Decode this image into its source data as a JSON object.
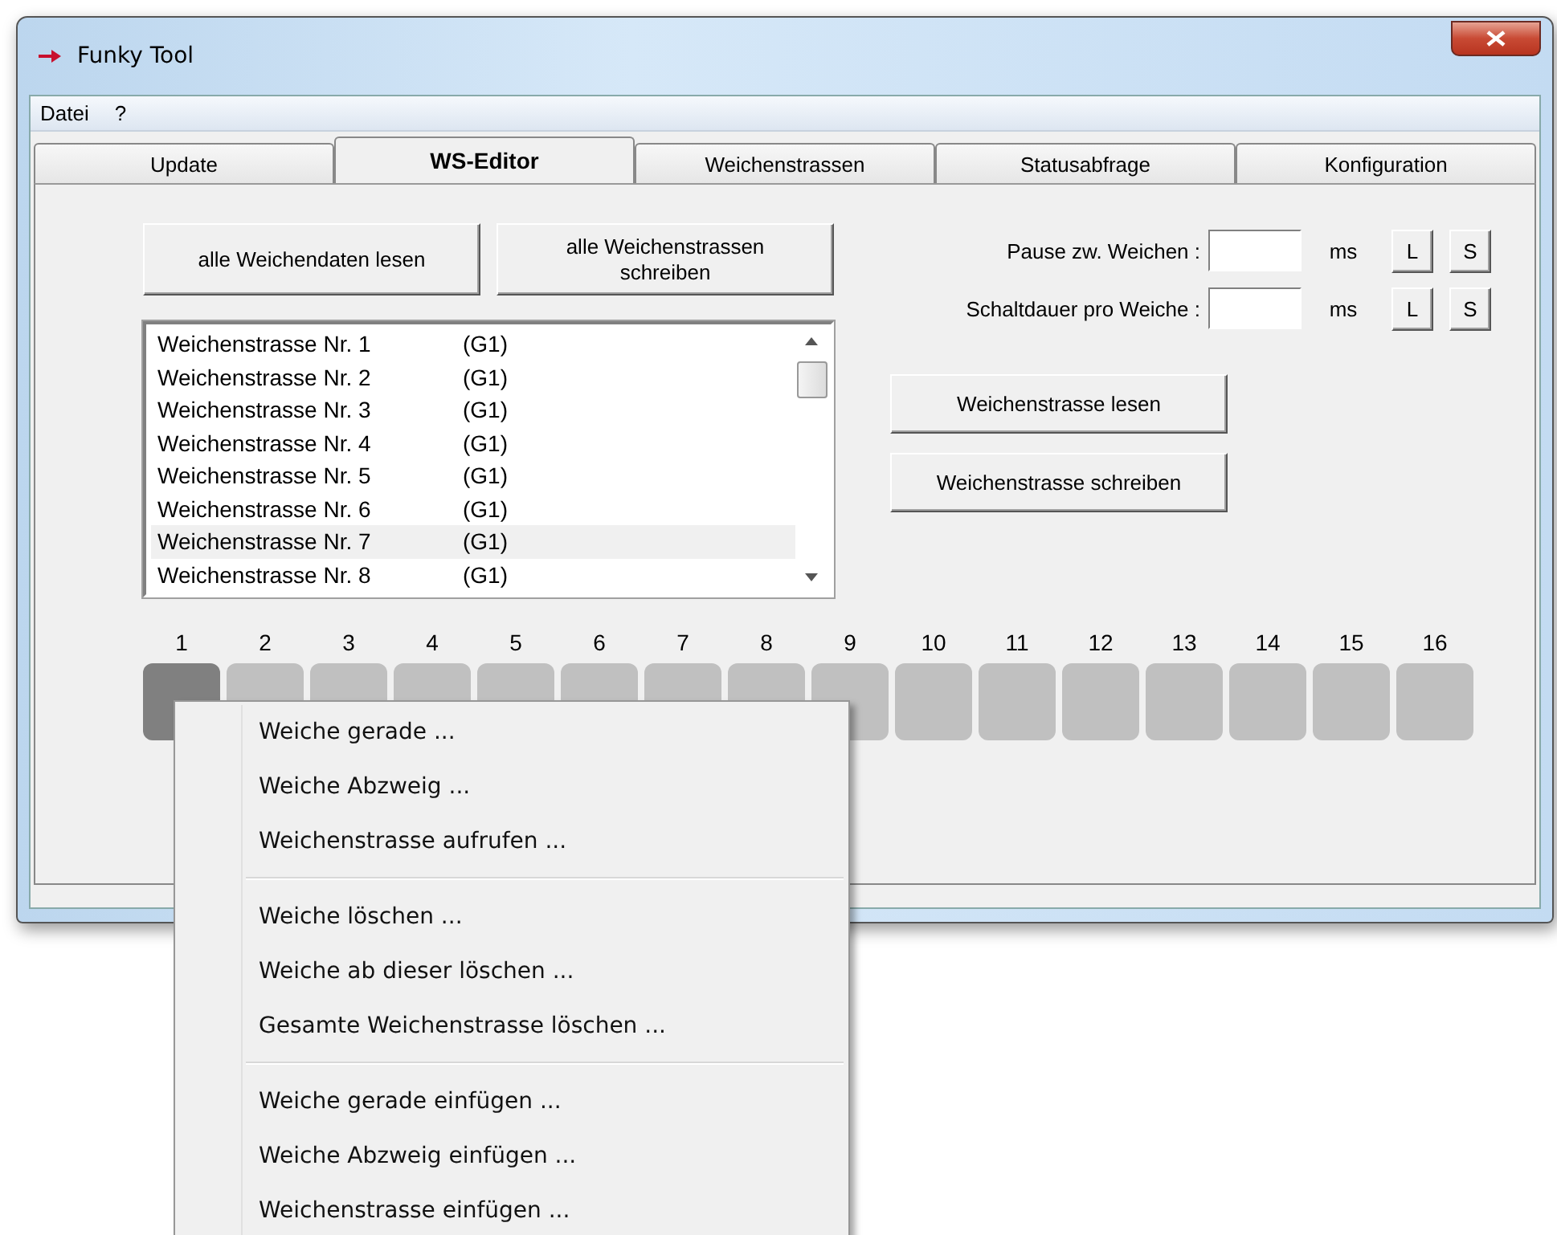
{
  "window": {
    "title": "Funky Tool"
  },
  "menu_bar": [
    "Datei",
    "?"
  ],
  "tabs": [
    {
      "label": "Update",
      "selected": false
    },
    {
      "label": "WS-Editor",
      "selected": true
    },
    {
      "label": "Weichenstrassen",
      "selected": false
    },
    {
      "label": "Statusabfrage",
      "selected": false
    },
    {
      "label": "Konfiguration",
      "selected": false
    }
  ],
  "top_buttons": [
    "alle Weichendaten lesen",
    "alle Weichenstrassen schreiben"
  ],
  "route_list": [
    {
      "name": "Weichenstrasse Nr. 1",
      "group": "(G1)",
      "selected": false
    },
    {
      "name": "Weichenstrasse Nr. 2",
      "group": "(G1)",
      "selected": false
    },
    {
      "name": "Weichenstrasse Nr. 3",
      "group": "(G1)",
      "selected": false
    },
    {
      "name": "Weichenstrasse Nr. 4",
      "group": "(G1)",
      "selected": false
    },
    {
      "name": "Weichenstrasse Nr. 5",
      "group": "(G1)",
      "selected": false
    },
    {
      "name": "Weichenstrasse Nr. 6",
      "group": "(G1)",
      "selected": false
    },
    {
      "name": "Weichenstrasse Nr. 7",
      "group": "(G1)",
      "selected": true
    },
    {
      "name": "Weichenstrasse Nr. 8",
      "group": "(G1)",
      "selected": false
    }
  ],
  "settings": [
    {
      "label": "Pause zw. Weichen :",
      "unit": "ms",
      "buttons": [
        "L",
        "S"
      ]
    },
    {
      "label": "Schaltdauer pro Weiche :",
      "unit": "ms",
      "buttons": [
        "L",
        "S"
      ]
    }
  ],
  "route_buttons": [
    "Weichenstrasse lesen",
    "Weichenstrasse schreiben"
  ],
  "slots": [
    {
      "number": "1",
      "selected": true
    },
    {
      "number": "2",
      "selected": false
    },
    {
      "number": "3",
      "selected": false
    },
    {
      "number": "4",
      "selected": false
    },
    {
      "number": "5",
      "selected": false
    },
    {
      "number": "6",
      "selected": false
    },
    {
      "number": "7",
      "selected": false
    },
    {
      "number": "8",
      "selected": false
    },
    {
      "number": "9",
      "selected": false
    },
    {
      "number": "10",
      "selected": false
    },
    {
      "number": "11",
      "selected": false
    },
    {
      "number": "12",
      "selected": false
    },
    {
      "number": "13",
      "selected": false
    },
    {
      "number": "14",
      "selected": false
    },
    {
      "number": "15",
      "selected": false
    },
    {
      "number": "16",
      "selected": false
    }
  ],
  "context_menu": {
    "groups": [
      [
        "Weiche gerade ...",
        "Weiche Abzweig ...",
        "Weichenstrasse aufrufen ..."
      ],
      [
        "Weiche löschen ...",
        "Weiche ab dieser löschen ...",
        "Gesamte Weichenstrasse löschen ..."
      ],
      [
        "Weiche gerade einfügen ...",
        "Weiche Abzweig einfügen ...",
        "Weichenstrasse einfügen ..."
      ]
    ]
  }
}
